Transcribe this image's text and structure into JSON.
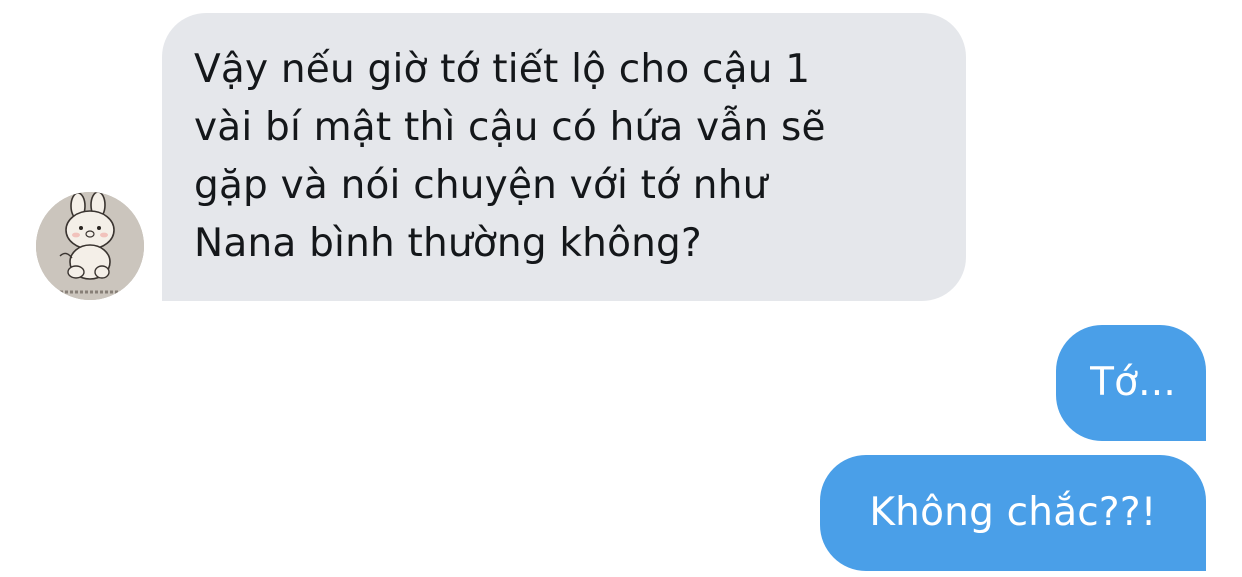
{
  "conversation": {
    "incoming": {
      "lines": [
        "Vậy nếu giờ tớ tiết lộ cho cậu 1",
        "vài bí mật thì cậu có hứa vẫn sẽ",
        "gặp và nói chuyện với tớ như",
        "Nana bình thường không?"
      ]
    },
    "outgoing": [
      "Tớ...",
      "Không chắc??!"
    ]
  },
  "avatar": {
    "icon": "bunny-avatar-icon"
  },
  "colors": {
    "incoming_bubble": "#e5e7eb",
    "outgoing_bubble": "#4a9fe8",
    "incoming_text": "#14171a",
    "outgoing_text": "#ffffff"
  }
}
